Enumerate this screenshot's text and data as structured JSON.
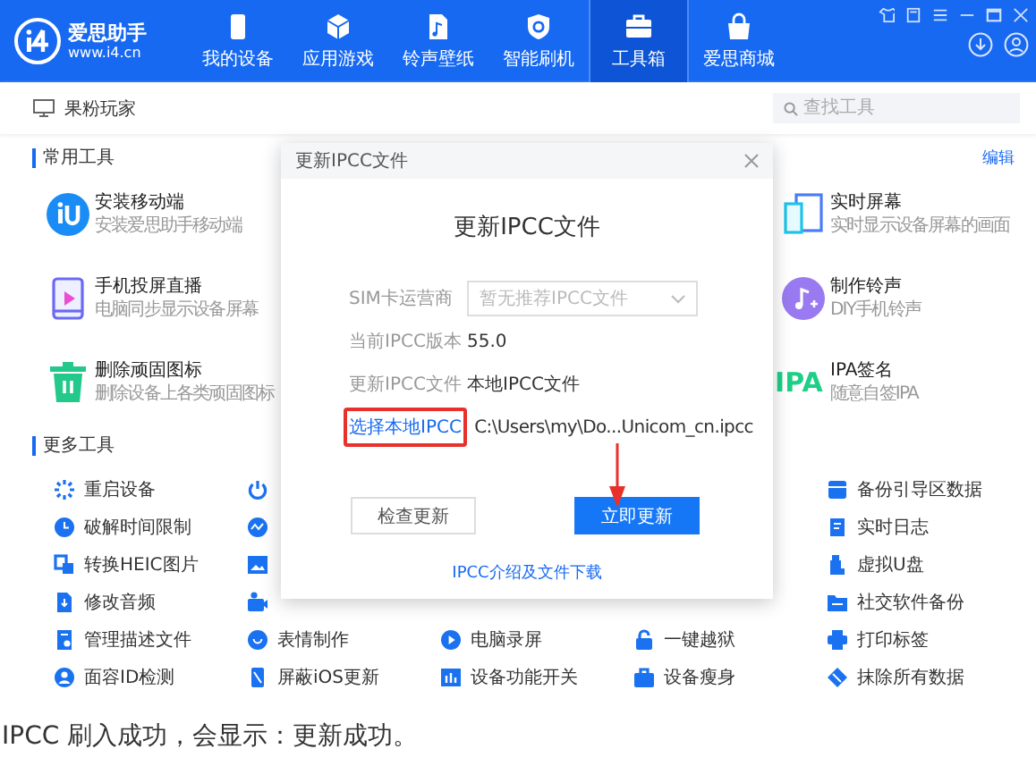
{
  "brand": {
    "name": "爱思助手",
    "url": "www.i4.cn"
  },
  "nav": [
    {
      "label": "我的设备",
      "selected": false
    },
    {
      "label": "应用游戏",
      "selected": false
    },
    {
      "label": "铃声壁纸",
      "selected": false
    },
    {
      "label": "智能刷机",
      "selected": false
    },
    {
      "label": "工具箱",
      "selected": true
    },
    {
      "label": "爱思商城",
      "selected": false
    }
  ],
  "toolbar": {
    "title": "果粉玩家",
    "search": {
      "placeholder": "查找工具"
    }
  },
  "common_tools": {
    "title": "常用工具",
    "edit_link": "编辑",
    "left": [
      {
        "name": "安装移动端",
        "description": "安装爱思助手移动端"
      },
      {
        "name": "手机投屏直播",
        "description": "电脑同步显示设备屏幕"
      },
      {
        "name": "删除顽固图标",
        "description": "删除设备上各类顽固图标"
      }
    ],
    "right": [
      {
        "name": "实时屏幕",
        "description": "实时显示设备屏幕的画面"
      },
      {
        "name": "制作铃声",
        "description": "DIY手机铃声"
      },
      {
        "icon_text": "IPA",
        "name": "IPA签名",
        "description": "随意自签IPA"
      }
    ]
  },
  "more_tools": {
    "title": "更多工具",
    "rows": [
      [
        {
          "kind": "tool",
          "label": "重启设备"
        },
        {
          "kind": "icon"
        },
        {
          "kind": "hidden"
        },
        {
          "kind": "hidden"
        },
        {
          "kind": "tool",
          "label": "备份引导区数据"
        }
      ],
      [
        {
          "kind": "tool",
          "label": "破解时间限制"
        },
        {
          "kind": "icon"
        },
        {
          "kind": "hidden"
        },
        {
          "kind": "hidden"
        },
        {
          "kind": "tool",
          "label": "实时日志"
        }
      ],
      [
        {
          "kind": "tool",
          "label": "转换HEIC图片"
        },
        {
          "kind": "icon"
        },
        {
          "kind": "hidden"
        },
        {
          "kind": "hidden"
        },
        {
          "kind": "tool",
          "label": "虚拟U盘"
        }
      ],
      [
        {
          "kind": "tool",
          "label": "修改音频"
        },
        {
          "kind": "icon"
        },
        {
          "kind": "hidden"
        },
        {
          "kind": "hidden"
        },
        {
          "kind": "tool",
          "label": "社交软件备份"
        }
      ],
      [
        {
          "kind": "tool",
          "label": "管理描述文件"
        },
        {
          "kind": "tool",
          "label": "表情制作"
        },
        {
          "kind": "tool",
          "label": "电脑录屏"
        },
        {
          "kind": "tool",
          "label": "一键越狱"
        },
        {
          "kind": "tool",
          "label": "打印标签"
        }
      ],
      [
        {
          "kind": "tool",
          "label": "面容ID检测"
        },
        {
          "kind": "tool",
          "label": "屏蔽iOS更新"
        },
        {
          "kind": "tool",
          "label": "设备功能开关"
        },
        {
          "kind": "tool",
          "label": "设备瘦身"
        },
        {
          "kind": "tool",
          "label": "抹除所有数据"
        }
      ]
    ]
  },
  "dialog": {
    "title": "更新IPCC文件",
    "heading": "更新IPCC文件",
    "fields": [
      {
        "kind": "select",
        "label": "SIM卡运营商",
        "placeholder": "暂无推荐IPCC文件"
      },
      {
        "kind": "text",
        "label": "当前IPCC版本",
        "value": "55.0"
      },
      {
        "kind": "text",
        "label": "更新IPCC文件",
        "value": "本地IPCC文件"
      },
      {
        "kind": "link",
        "label": "选择本地IPCC",
        "value": "C:\\Users\\my\\Do...Unicom_cn.ipcc",
        "highlighted": true
      }
    ],
    "buttons": [
      {
        "label": "检查更新",
        "primary": false
      },
      {
        "label": "立即更新",
        "primary": true
      }
    ],
    "footer_link": "IPCC介绍及文件下载"
  },
  "caption": "IPCC 刷入成功，会显示：更新成功。"
}
